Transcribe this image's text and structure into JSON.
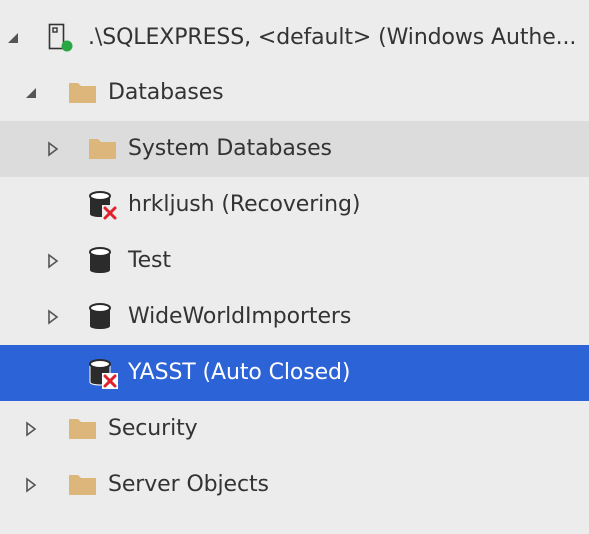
{
  "colors": {
    "background": "#ececec",
    "hover": "#dcdcdc",
    "selected": "#2c63d6",
    "text": "#333333",
    "text_selected": "#ffffff",
    "folder": "#dcb67a",
    "database": "#2b2b2b",
    "connected": "#28a745",
    "error": "#e0202a"
  },
  "tree": {
    "server": {
      "label": ".\\SQLEXPRESS, <default> (Windows Authe...",
      "icon": "server-connected-icon",
      "expanded": true
    },
    "databases_folder": {
      "label": "Databases",
      "icon": "folder-icon",
      "expanded": true
    },
    "system_databases": {
      "label": "System Databases",
      "icon": "folder-icon",
      "expanded": false
    },
    "db_hrkljush": {
      "label": "hrkljush (Recovering)",
      "icon": "database-error-icon"
    },
    "db_test": {
      "label": "Test",
      "icon": "database-icon",
      "expanded": false
    },
    "db_wideworldimporters": {
      "label": "WideWorldImporters",
      "icon": "database-icon",
      "expanded": false
    },
    "db_yasst": {
      "label": "YASST (Auto Closed)",
      "icon": "database-error-icon",
      "selected": true
    },
    "security_folder": {
      "label": "Security",
      "icon": "folder-icon",
      "expanded": false
    },
    "server_objects_folder": {
      "label": "Server Objects",
      "icon": "folder-icon",
      "expanded": false
    }
  }
}
